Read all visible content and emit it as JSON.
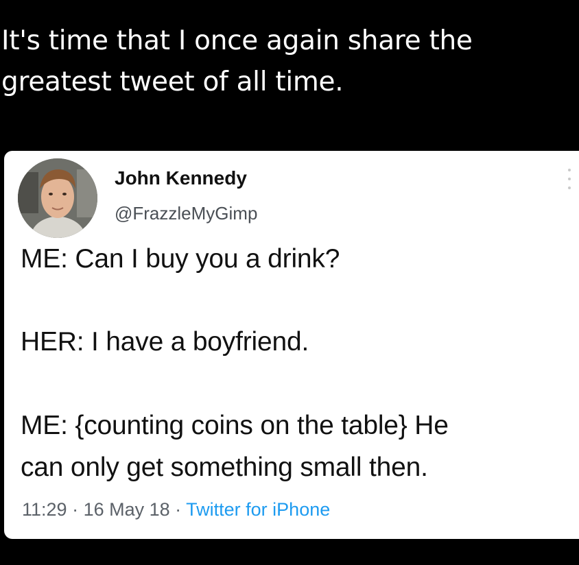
{
  "caption": {
    "line1": "It's time that I once again share the",
    "line2": "greatest tweet of all time."
  },
  "tweet": {
    "author_name": "John Kennedy",
    "author_handle": "@FrazzleMyGimp",
    "avatar_icon": "profile-photo",
    "more_icon": "more-options-icon",
    "lines": [
      "ME: Can I buy you a drink?",
      "HER: I have a boyfriend.",
      "ME: {counting coins on the table} He",
      "can only get something small then."
    ],
    "time": "11:29",
    "separator": " · ",
    "date": "16 May 18",
    "source": "Twitter for iPhone"
  },
  "colors": {
    "background": "#000000",
    "card": "#ffffff",
    "link": "#1d9bf0",
    "meta": "#5b6168"
  }
}
